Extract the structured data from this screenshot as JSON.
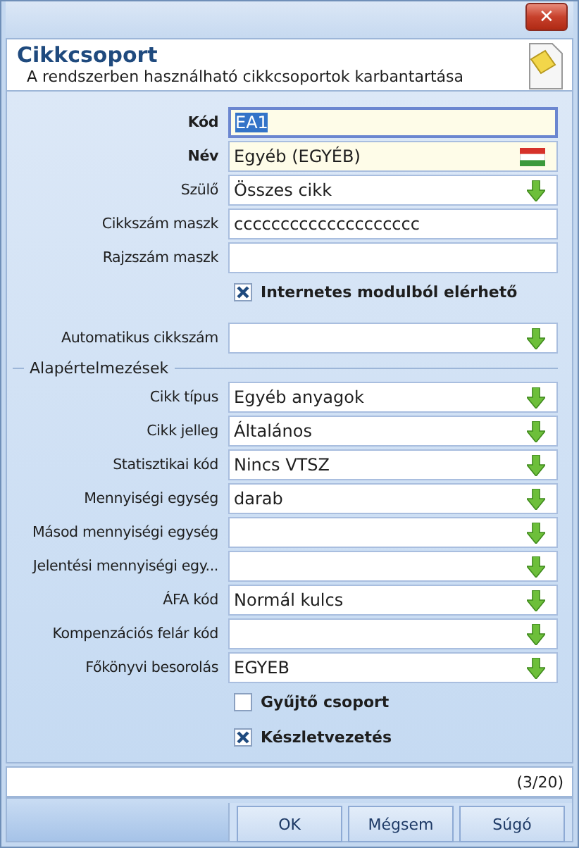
{
  "window": {
    "close_label": "✕"
  },
  "header": {
    "title": "Cikkcsoport",
    "subtitle": "A rendszerben használható cikkcsoportok karbantartása"
  },
  "form": [
    {
      "kind": "text",
      "label": "Kód",
      "required": true,
      "value": "EA1",
      "focused": true
    },
    {
      "kind": "language",
      "label": "Név",
      "required": true,
      "value": "Egyéb (EGYÉB)",
      "focused": false
    },
    {
      "kind": "combo",
      "label": "Szülő",
      "required": false,
      "value": "Összes cikk",
      "focused": false
    },
    {
      "kind": "text",
      "label": "Cikkszám maszk",
      "required": false,
      "value": "cccccccccccccccccccc",
      "focused": false
    },
    {
      "kind": "text",
      "label": "Rajzszám maszk",
      "required": false,
      "focused": false
    },
    {
      "kind": "checkbox",
      "label": "Internetes modulból elérhető",
      "checked": true
    },
    {
      "kind": "combo",
      "label": "Automatikus cikkszám",
      "required": false,
      "focused": false
    },
    {
      "kind": "section",
      "label": "Alapértelmezések"
    },
    {
      "kind": "combo",
      "label": "Cikk típus",
      "required": false,
      "value": "Egyéb anyagok",
      "focused": false
    },
    {
      "kind": "combo",
      "label": "Cikk jelleg",
      "required": false,
      "value": "Általános",
      "focused": false
    },
    {
      "kind": "combo",
      "label": "Statisztikai kód",
      "required": false,
      "value": "Nincs VTSZ",
      "focused": false
    },
    {
      "kind": "combo",
      "label": "Mennyiségi egység",
      "required": false,
      "value": "darab",
      "focused": false
    },
    {
      "kind": "combo",
      "label": "Másod mennyiségi egység",
      "required": false,
      "focused": false
    },
    {
      "kind": "combo",
      "label": "Jelentési mennyiségi egy...",
      "required": false,
      "focused": false
    },
    {
      "kind": "combo",
      "label": "ÁFA kód",
      "required": false,
      "value": "Normál kulcs",
      "focused": false
    },
    {
      "kind": "combo",
      "label": "Kompenzációs felár kód",
      "required": false,
      "focused": false
    },
    {
      "kind": "combo",
      "label": "Főkönyvi besorolás",
      "required": false,
      "value": "EGYEB",
      "focused": false
    },
    {
      "kind": "checkbox",
      "label": "Gyűjtő csoport",
      "checked": false
    },
    {
      "kind": "checkbox",
      "label": "Készletvezetés",
      "checked": true
    }
  ],
  "status": {
    "counter": "(3/20)"
  },
  "buttons": [
    "OK",
    "Mégsem",
    "Súgó"
  ]
}
